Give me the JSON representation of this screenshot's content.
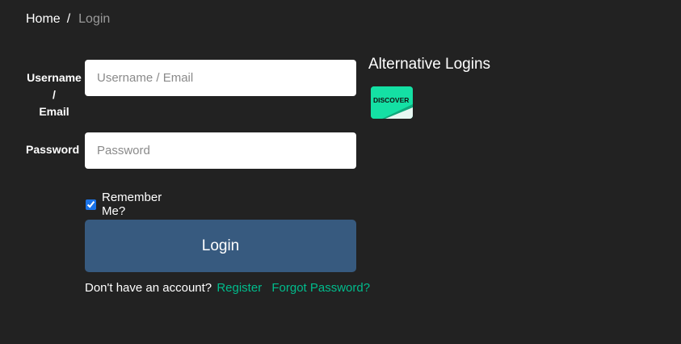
{
  "breadcrumb": {
    "home": "Home",
    "separator": "/",
    "current": "Login"
  },
  "form": {
    "username_label_line1": "Username",
    "username_label_line2": "/",
    "username_label_line3": "Email",
    "username_placeholder": "Username / Email",
    "username_value": "",
    "password_label": "Password",
    "password_placeholder": "Password",
    "password_value": "",
    "remember_label": "Remember Me?",
    "remember_checked": true,
    "login_button": "Login",
    "no_account_text": "Don't have an account?",
    "register_link": "Register",
    "forgot_link": "Forgot Password?"
  },
  "alternative": {
    "title": "Alternative Logins",
    "providers": [
      {
        "name": "DISCOVER",
        "icon": "discover-card-icon",
        "color": "#14e0a4"
      }
    ]
  },
  "colors": {
    "background": "#222222",
    "button": "#375a7f",
    "link": "#00bc8c",
    "muted": "#9a9a9a"
  }
}
